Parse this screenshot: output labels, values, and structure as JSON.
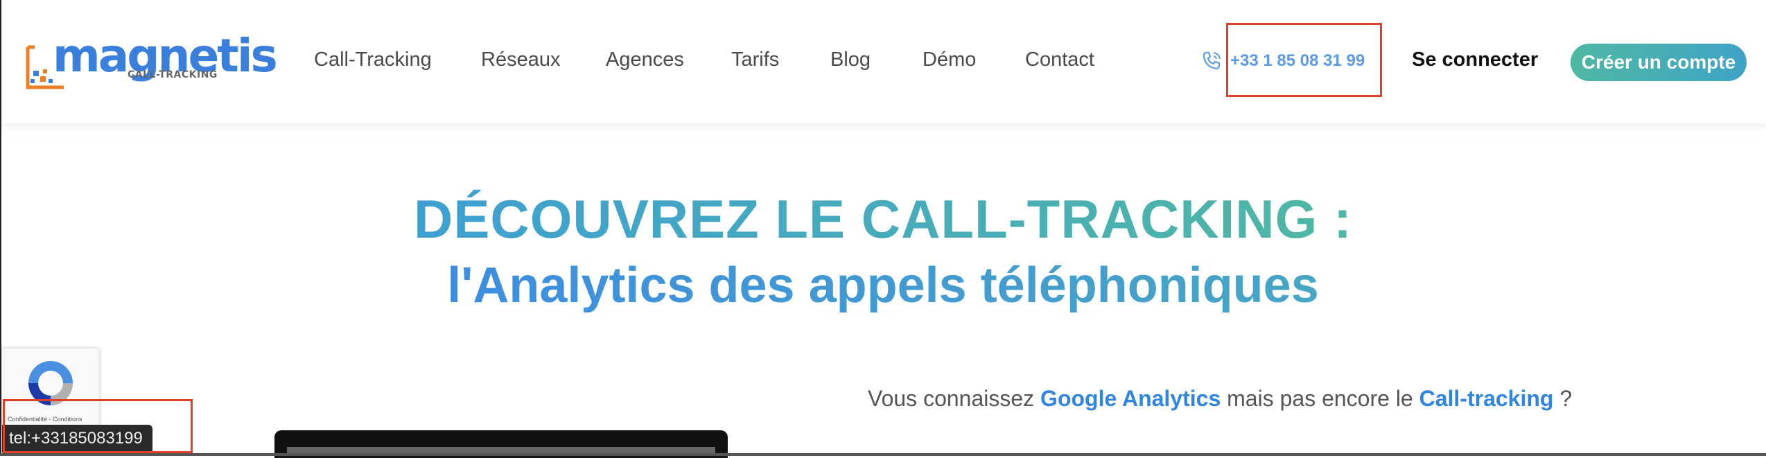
{
  "logo": {
    "name": "magnetis",
    "tagline": "CALL-TRACKING"
  },
  "nav": {
    "items": [
      "Call-Tracking",
      "Réseaux",
      "Agences",
      "Tarifs",
      "Blog",
      "Démo",
      "Contact"
    ]
  },
  "contact": {
    "phone": "+33 1 85 08 31 99",
    "icon": "phone-ringing-icon"
  },
  "account": {
    "login": "Se connecter",
    "signup": "Créer un compte"
  },
  "hero": {
    "title_line1": "DÉCOUVREZ LE CALL-TRACKING :",
    "title_line2": "l'Analytics des appels téléphoniques"
  },
  "intro": {
    "part1": "Vous connaissez ",
    "highlight1": "Google Analytics",
    "part2": " mais pas encore le ",
    "highlight2": "Call-tracking",
    "part3": " ?"
  },
  "recaptcha": {
    "links": "Confidentialité - Conditions"
  },
  "statusbar": {
    "url": "tel:+33185083199"
  },
  "colors": {
    "brand_blue": "#3b7fdd",
    "accent_teal": "#4fb8a3",
    "link_blue": "#2f86e0",
    "highlight_red": "#e0402a"
  }
}
